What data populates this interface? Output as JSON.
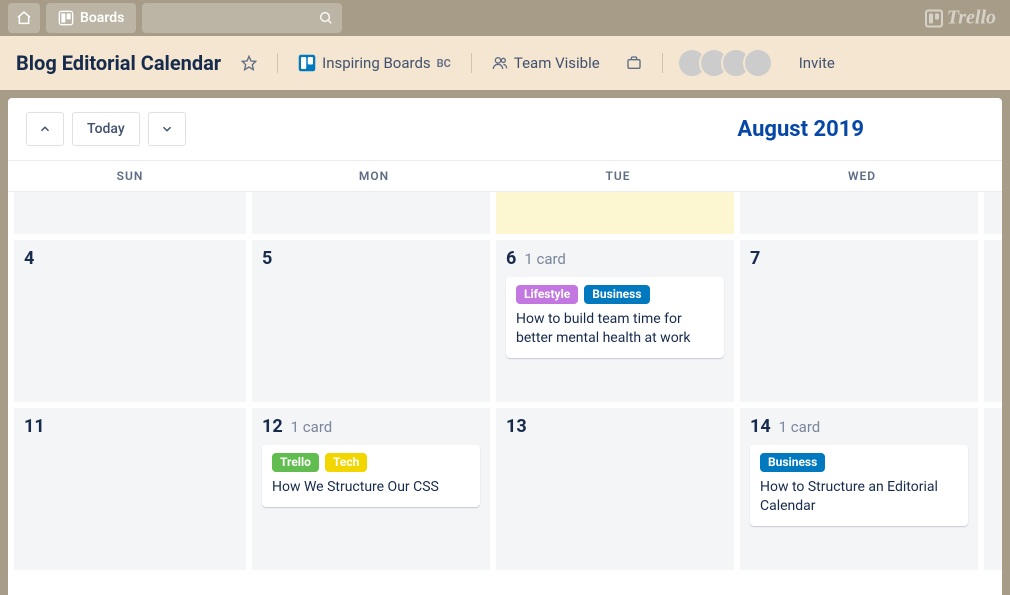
{
  "topbar": {
    "boards_label": "Boards",
    "logo_text": "Trello"
  },
  "board_header": {
    "title": "Blog Editorial Calendar",
    "team_button": "Inspiring Boards",
    "team_badge": "BC",
    "visibility": "Team Visible",
    "invite": "Invite"
  },
  "calendar": {
    "today_label": "Today",
    "month_label": "August 2019",
    "day_names": [
      "SUN",
      "MON",
      "TUE",
      "WED"
    ],
    "row1": {
      "sun": {
        "num": "4"
      },
      "mon": {
        "num": "5"
      },
      "tue": {
        "num": "6",
        "count": "1 card",
        "card": {
          "labels": [
            {
              "text": "Lifestyle",
              "cls": "l-lifestyle"
            },
            {
              "text": "Business",
              "cls": "l-business"
            }
          ],
          "title": "How to build team time for better mental health at work"
        }
      },
      "wed": {
        "num": "7"
      }
    },
    "row2": {
      "sun": {
        "num": "11"
      },
      "mon": {
        "num": "12",
        "count": "1 card",
        "card": {
          "labels": [
            {
              "text": "Trello",
              "cls": "l-trello"
            },
            {
              "text": "Tech",
              "cls": "l-tech"
            }
          ],
          "title": "How We Structure Our CSS"
        }
      },
      "tue": {
        "num": "13"
      },
      "wed": {
        "num": "14",
        "count": "1 card",
        "card": {
          "labels": [
            {
              "text": "Business",
              "cls": "l-business"
            }
          ],
          "title": "How to Structure an Editorial Calendar"
        }
      }
    }
  }
}
